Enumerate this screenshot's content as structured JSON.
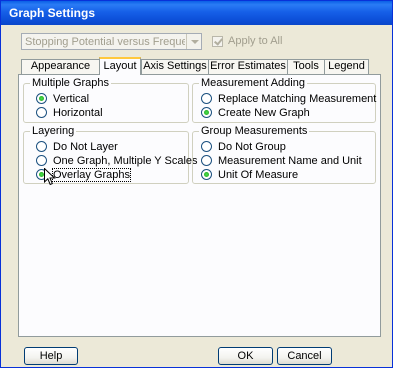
{
  "window": {
    "title": "Graph Settings"
  },
  "toolbar": {
    "graph_select_value": "Stopping Potential versus Frequen",
    "apply_all_label": "Apply to All"
  },
  "tabs": [
    {
      "label": "Appearance"
    },
    {
      "label": "Layout"
    },
    {
      "label": "Axis Settings"
    },
    {
      "label": "Error Estimates"
    },
    {
      "label": "Tools"
    },
    {
      "label": "Legend"
    }
  ],
  "active_tab": "Layout",
  "groups": {
    "multiple_graphs": {
      "title": "Multiple Graphs",
      "options": [
        {
          "label": "Vertical",
          "selected": true
        },
        {
          "label": "Horizontal",
          "selected": false
        }
      ]
    },
    "measurement_adding": {
      "title": "Measurement Adding",
      "options": [
        {
          "label": "Replace Matching Measurement",
          "selected": false
        },
        {
          "label": "Create New Graph",
          "selected": true
        }
      ]
    },
    "layering": {
      "title": "Layering",
      "options": [
        {
          "label": "Do Not Layer",
          "selected": false
        },
        {
          "label": "One Graph, Multiple Y Scales",
          "selected": false
        },
        {
          "label": "Overlay Graphs",
          "selected": true
        }
      ]
    },
    "group_measurements": {
      "title": "Group Measurements",
      "options": [
        {
          "label": "Do Not Group",
          "selected": false
        },
        {
          "label": "Measurement Name and Unit",
          "selected": false
        },
        {
          "label": "Unit Of Measure",
          "selected": true
        }
      ]
    }
  },
  "footer": {
    "help_label": "Help",
    "ok_label": "OK",
    "cancel_label": "Cancel"
  },
  "colors": {
    "titlebar": "#0a5fe6",
    "dialog_bg": "#ece9d8",
    "panel_bg": "#fcfcfe",
    "active_tab_accent": "#ffc83c",
    "radio_selected": "#21a121"
  }
}
